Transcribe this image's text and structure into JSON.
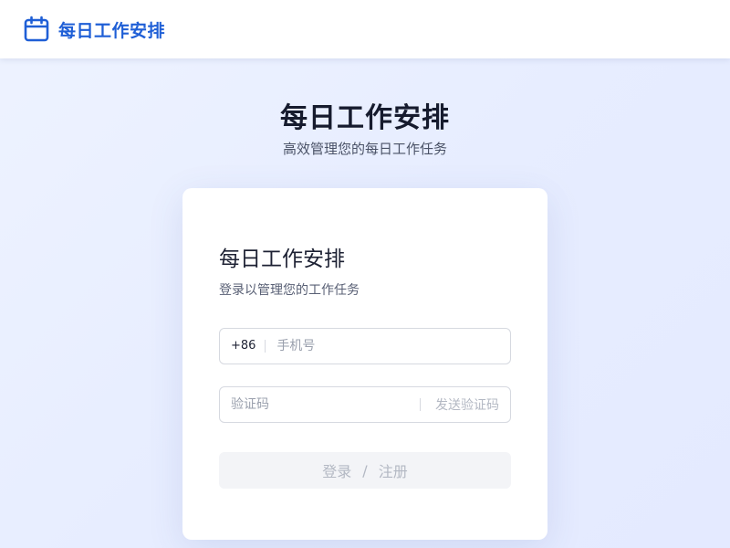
{
  "header": {
    "brand_icon": "calendar-icon",
    "brand_name": "每日工作安排"
  },
  "hero": {
    "title": "每日工作安排",
    "subtitle": "高效管理您的每日工作任务"
  },
  "card": {
    "title": "每日工作安排",
    "subtitle": "登录以管理您的工作任务",
    "phone": {
      "prefix": "+86",
      "placeholder": "手机号",
      "value": ""
    },
    "code": {
      "placeholder": "验证码",
      "value": "",
      "send_label": "发送验证码"
    },
    "submit": {
      "login_label": "登录",
      "separator": "/",
      "register_label": "注册"
    }
  },
  "colors": {
    "brand": "#1f5fd6",
    "title": "#161b2e",
    "disabled_text": "#b3b8c3",
    "disabled_bg": "#f3f4f7"
  }
}
